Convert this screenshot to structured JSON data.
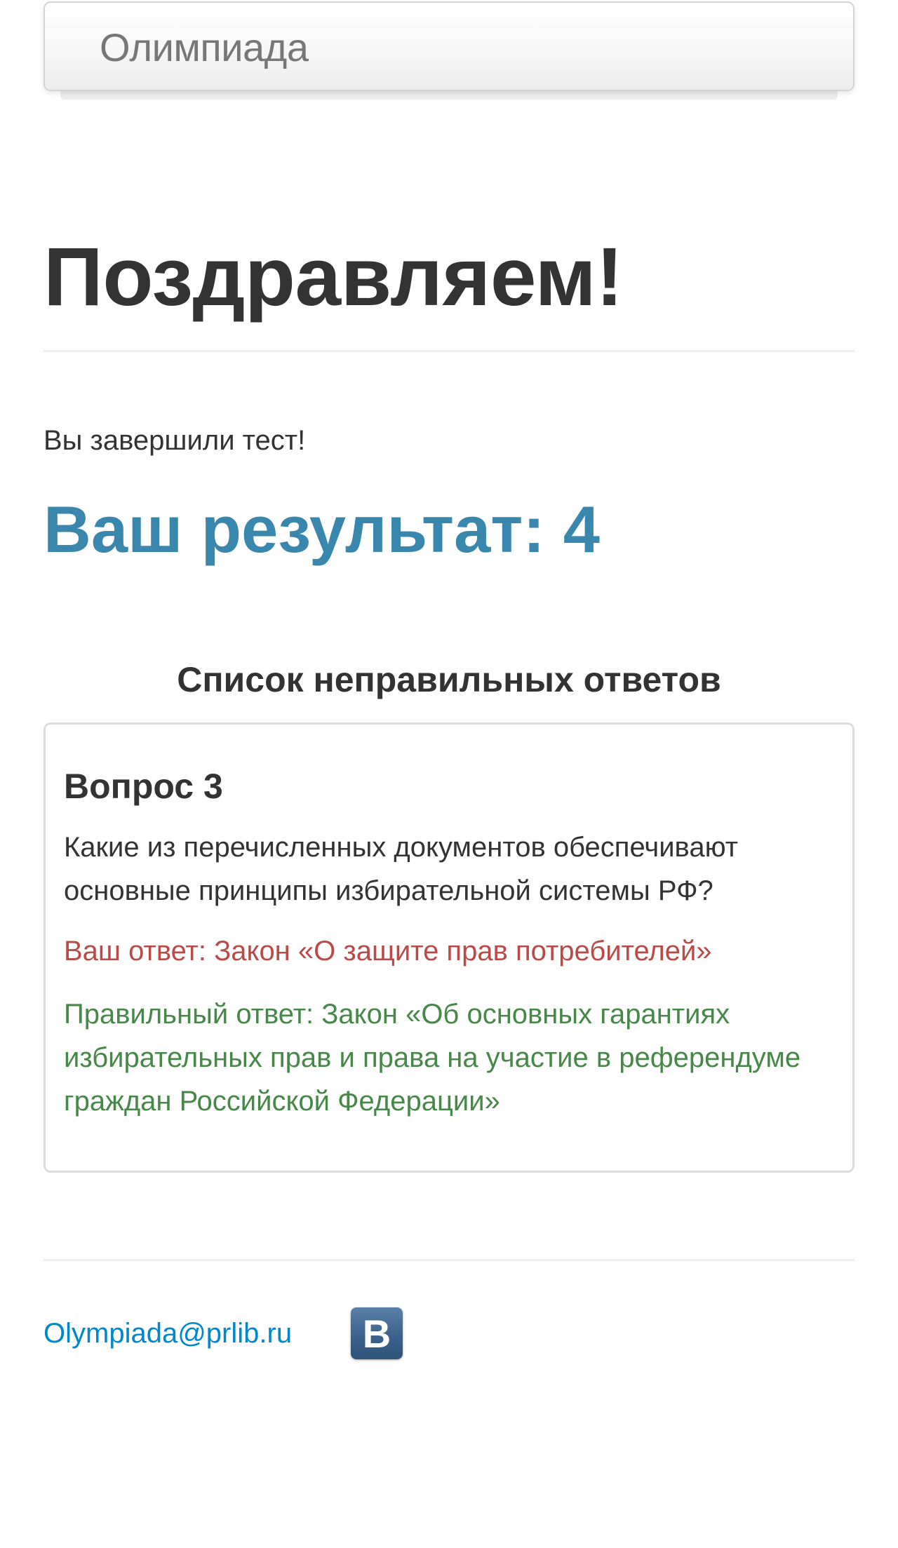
{
  "navbar": {
    "brand": "Олимпиада"
  },
  "header": {
    "title": "Поздравляем!"
  },
  "main": {
    "finished_text": "Вы завершили тест!",
    "result_text": "Ваш результат: 4",
    "wrong_list_title": "Список неправильных ответов",
    "questions": [
      {
        "number_label": "Вопрос 3",
        "text": "Какие из перечисленных документов обеспечивают основные принципы избирательной системы РФ?",
        "your_answer": "Ваш ответ: Закон «О защите прав потребителей»",
        "correct_answer": "Правильный ответ: Закон «Об основных гарантиях избирательных прав и права на участие в референдуме граждан Российской Федерации»"
      }
    ]
  },
  "footer": {
    "email": "Olympiada@prlib.ru",
    "vk_icon": "vk-icon",
    "vk_letter": "B"
  },
  "colors": {
    "result": "#3a87ad",
    "wrong_answer": "#b94a48",
    "correct_answer": "#468847",
    "link": "#0088cc",
    "vk_brand": "#45688e"
  }
}
